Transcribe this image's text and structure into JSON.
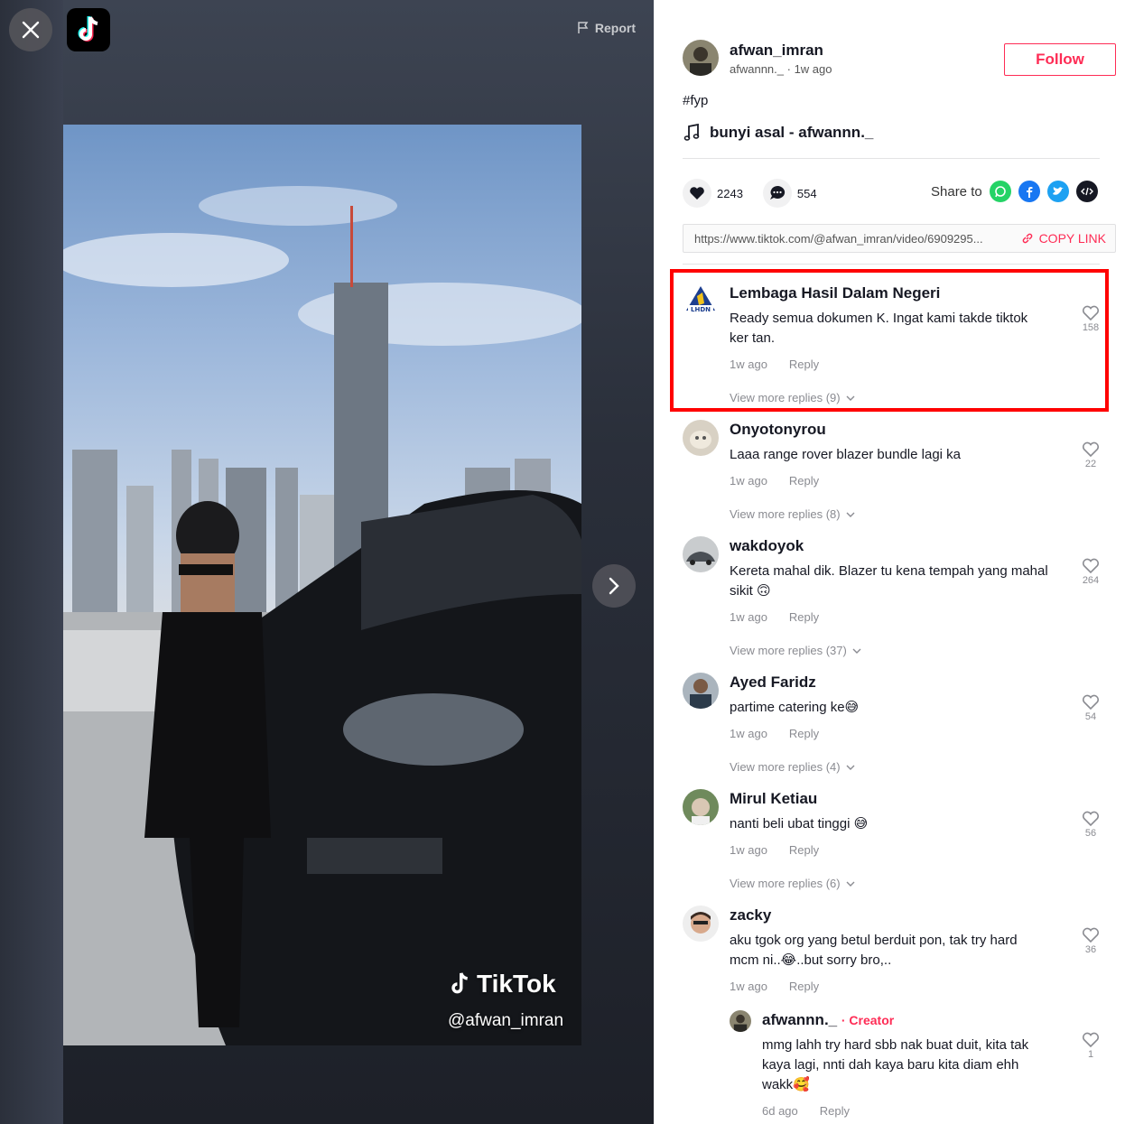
{
  "video": {
    "report_label": "Report",
    "watermark_brand": "TikTok",
    "watermark_handle": "@afwan_imran"
  },
  "author": {
    "name": "afwan_imran",
    "handle": "afwannn._",
    "time": "1w ago",
    "follow_label": "Follow"
  },
  "post": {
    "description": "#fyp",
    "music": "bunyi asal - afwannn._"
  },
  "stats": {
    "likes": "2243",
    "comments": "554",
    "share_label": "Share to"
  },
  "link": {
    "url": "https://www.tiktok.com/@afwan_imran/video/6909295...",
    "copy_label": "COPY LINK"
  },
  "colors": {
    "accent": "#fe2c55",
    "highlight": "#ff0000",
    "whatsapp": "#25d366",
    "facebook": "#1877f2",
    "twitter": "#1da1f2",
    "embed": "#161823"
  },
  "comments": [
    {
      "name": "Lembaga Hasil Dalam Negeri",
      "text1": "Ready semua dokumen K. Ingat kami takde tiktok",
      "text2": "ker tan.",
      "time": "1w ago",
      "reply": "Reply",
      "more": "View more replies (9)",
      "likes": "158"
    },
    {
      "name": "Onyotonyrou",
      "text1": "Laaa range rover blazer bundle lagi ka",
      "text2": "",
      "time": "1w ago",
      "reply": "Reply",
      "more": "View more replies (8)",
      "likes": "22"
    },
    {
      "name": "wakdoyok",
      "text1": "Kereta mahal dik. Blazer tu kena tempah yang mahal",
      "text2": "sikit 🙃",
      "time": "1w ago",
      "reply": "Reply",
      "more": "View more replies (37)",
      "likes": "264"
    },
    {
      "name": "Ayed Faridz",
      "text1": "partime catering ke😅",
      "text2": "",
      "time": "1w ago",
      "reply": "Reply",
      "more": "View more replies (4)",
      "likes": "54"
    },
    {
      "name": "Mirul Ketiau",
      "text1": "nanti beli ubat tinggi 😅",
      "text2": "",
      "time": "1w ago",
      "reply": "Reply",
      "more": "View more replies (6)",
      "likes": "56"
    },
    {
      "name": "zacky",
      "text1": "aku tgok org yang betul berduit pon, tak try hard",
      "text2": "mcm ni..😂..but sorry bro,..",
      "time": "1w ago",
      "reply": "Reply",
      "likes": "36"
    }
  ],
  "creator_reply": {
    "name": "afwannn._",
    "tag": "Creator",
    "text1": "mmg lahh try hard sbb nak buat duit, kita tak",
    "text2": "kaya lagi, nnti dah kaya baru kita diam ehh",
    "text3": "wakk🥰",
    "time": "6d ago",
    "reply": "Reply",
    "likes": "1"
  }
}
